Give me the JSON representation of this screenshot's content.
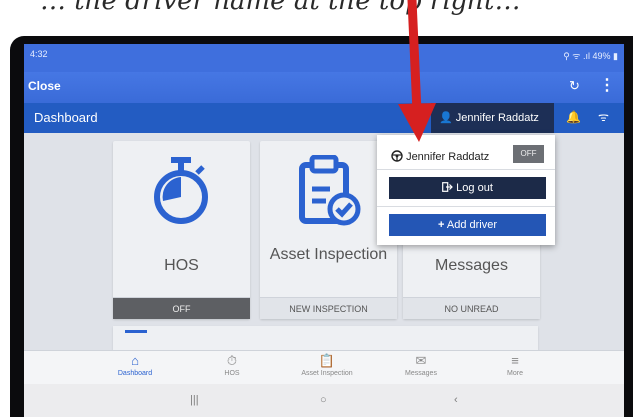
{
  "caption": {
    "text": "… the driver name at the top right…"
  },
  "status_bar": {
    "time": "4:32",
    "indicators": "⚲ ᯤ .ıl 49% ▮"
  },
  "app_bar": {
    "close_label": "Close",
    "refresh_icon": "↻",
    "more_icon": "⋮"
  },
  "nav_bar": {
    "title": "Dashboard",
    "user_label": "Jennifer Raddatz",
    "user_icon": "👤",
    "bell_icon": "🔔",
    "wifi_icon": "ᯤ"
  },
  "tiles": [
    {
      "name": "hos",
      "label": "HOS",
      "footer": "OFF"
    },
    {
      "name": "asset",
      "label": "Asset Inspection",
      "footer": "NEW INSPECTION"
    },
    {
      "name": "messages",
      "label": "Messages",
      "footer": "NO UNREAD"
    }
  ],
  "dropdown": {
    "driver_name": "Jennifer Raddatz",
    "status": "OFF",
    "logout_label": "Log out",
    "add_driver_label": "Add driver"
  },
  "tabbar": [
    {
      "label": "Dashboard",
      "icon": "⌂",
      "active": true
    },
    {
      "label": "HOS",
      "icon": "⏱",
      "active": false
    },
    {
      "label": "Asset Inspection",
      "icon": "📋",
      "active": false
    },
    {
      "label": "Messages",
      "icon": "✉",
      "active": false
    },
    {
      "label": "More",
      "icon": "≡",
      "active": false
    }
  ],
  "system_nav": {
    "recents": "|||",
    "home": "○",
    "back": "‹"
  },
  "colors": {
    "accent": "#2b62d0",
    "arrow": "#d62020",
    "bar_dark": "#1d2f56"
  }
}
